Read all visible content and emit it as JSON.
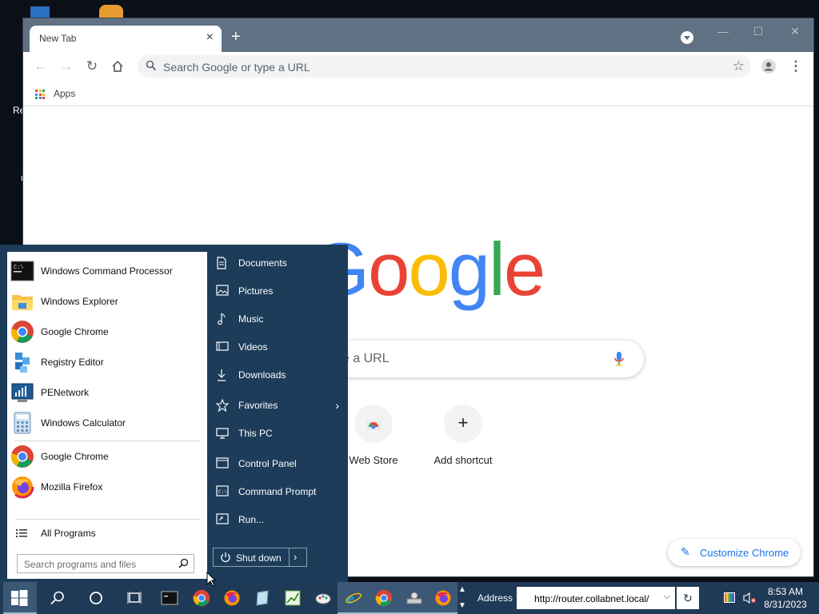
{
  "desktop": {
    "label_re": "Re",
    "label_u": "U"
  },
  "browser": {
    "tab_title": "New Tab",
    "tab_close": "×",
    "new_tab": "+",
    "window_controls": {
      "minimize": "—",
      "maximize": "☐",
      "close": "✕"
    },
    "omnibox_placeholder": "Search Google or type a URL",
    "bookmark_apps": "Apps",
    "google_logo": [
      "G",
      "o",
      "o",
      "g",
      "l",
      "e"
    ],
    "google_colors": [
      "#4285F4",
      "#EA4335",
      "#FBBC05",
      "#4285F4",
      "#34A853",
      "#EA4335"
    ],
    "search_placeholder_fragment": "pe a URL",
    "shortcuts": [
      {
        "label": "Web Store"
      },
      {
        "label": "Add shortcut",
        "icon": "+"
      }
    ],
    "customize_label": "Customize Chrome"
  },
  "start_menu": {
    "pinned": [
      {
        "label": "Windows Command Processor",
        "icon": "cmd-icon"
      },
      {
        "label": "Windows Explorer",
        "icon": "folder-icon"
      },
      {
        "label": "Google Chrome",
        "icon": "chrome-icon"
      },
      {
        "label": "Registry Editor",
        "icon": "registry-icon"
      },
      {
        "label": "PENetwork",
        "icon": "network-icon"
      },
      {
        "label": "Windows Calculator",
        "icon": "calculator-icon"
      }
    ],
    "recent": [
      {
        "label": "Google Chrome",
        "icon": "chrome-icon"
      },
      {
        "label": "Mozilla Firefox",
        "icon": "firefox-icon"
      }
    ],
    "all_programs": "All Programs",
    "search_placeholder": "Search programs and files",
    "places": [
      {
        "label": "Documents",
        "icon": "documents-icon"
      },
      {
        "label": "Pictures",
        "icon": "pictures-icon"
      },
      {
        "label": "Music",
        "icon": "music-icon"
      },
      {
        "label": "Videos",
        "icon": "videos-icon"
      },
      {
        "label": "Downloads",
        "icon": "downloads-icon"
      },
      {
        "label": "Favorites",
        "icon": "star-icon",
        "submenu": "›"
      },
      {
        "label": "This PC",
        "icon": "computer-icon"
      },
      {
        "label": "Control Panel",
        "icon": "control-panel-icon"
      },
      {
        "label": "Command Prompt",
        "icon": "cmd-icon"
      },
      {
        "label": "Run...",
        "icon": "run-icon"
      }
    ],
    "shutdown": "Shut down",
    "shutdown_more": "›"
  },
  "taskbar": {
    "address_label": "Address",
    "address_value": "http://router.collabnet.local/",
    "address_dropdown": "⌵",
    "refresh": "↻",
    "scroll_up": "▲",
    "scroll_down": "▼",
    "time": "8:53 AM",
    "date": "8/31/2023"
  },
  "colors": {
    "taskbar_bg": "#1f3a56",
    "start_menu_bg": "#1c3c5a",
    "chrome_frame": "#5f7182",
    "accent_blue": "#1a73e8"
  }
}
